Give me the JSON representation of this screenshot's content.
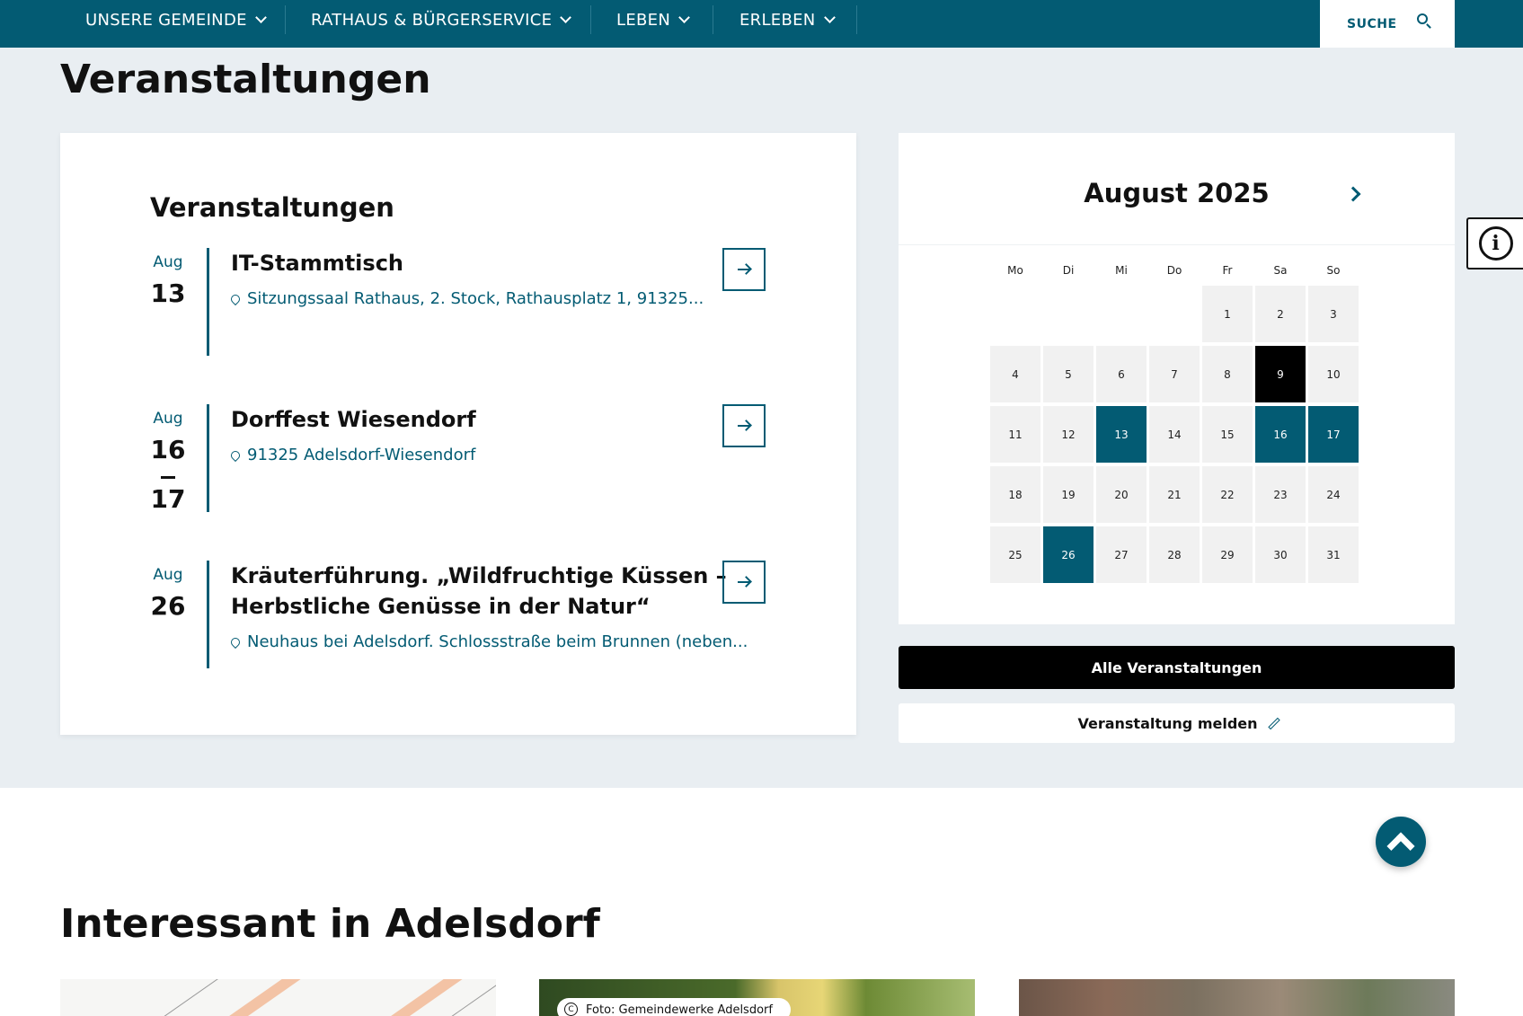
{
  "nav": {
    "items": [
      {
        "label": "UNSERE GEMEINDE"
      },
      {
        "label": "RATHAUS & BÜRGERSERVICE"
      },
      {
        "label": "LEBEN"
      },
      {
        "label": "ERLEBEN"
      }
    ],
    "search_label": "SUCHE"
  },
  "events_section": {
    "heading": "Veranstaltungen",
    "card_title": "Veranstaltungen",
    "events": [
      {
        "month": "Aug",
        "day": "13",
        "title": "IT-Stammtisch",
        "location": "Sitzungssaal Rathaus, 2. Stock, Rathausplatz 1, 91325..."
      },
      {
        "month": "Aug",
        "day": "16",
        "day_end": "17",
        "title": "Dorffest Wiesendorf",
        "location": "91325 Adelsdorf-Wiesendorf"
      },
      {
        "month": "Aug",
        "day": "26",
        "title_line1": "Kräuterführung. „Wildfruchtige Küssen –",
        "title_line2": "Herbstliche Genüsse in der Natur“",
        "location": "Neuhaus bei Adelsdorf. Schlossstraße beim Brunnen (neben..."
      }
    ]
  },
  "calendar": {
    "month_label": "August 2025",
    "weekdays": [
      "Mo",
      "Di",
      "Mi",
      "Do",
      "Fr",
      "Sa",
      "So"
    ],
    "days": [
      {
        "label": "",
        "state": "empty"
      },
      {
        "label": "",
        "state": "empty"
      },
      {
        "label": "",
        "state": "empty"
      },
      {
        "label": "",
        "state": "empty"
      },
      {
        "label": "1",
        "state": "normal"
      },
      {
        "label": "2",
        "state": "normal"
      },
      {
        "label": "3",
        "state": "normal"
      },
      {
        "label": "4",
        "state": "normal"
      },
      {
        "label": "5",
        "state": "normal"
      },
      {
        "label": "6",
        "state": "normal"
      },
      {
        "label": "7",
        "state": "normal"
      },
      {
        "label": "8",
        "state": "normal"
      },
      {
        "label": "9",
        "state": "today"
      },
      {
        "label": "10",
        "state": "normal"
      },
      {
        "label": "11",
        "state": "normal"
      },
      {
        "label": "12",
        "state": "normal"
      },
      {
        "label": "13",
        "state": "event"
      },
      {
        "label": "14",
        "state": "normal"
      },
      {
        "label": "15",
        "state": "normal"
      },
      {
        "label": "16",
        "state": "event"
      },
      {
        "label": "17",
        "state": "event"
      },
      {
        "label": "18",
        "state": "normal"
      },
      {
        "label": "19",
        "state": "normal"
      },
      {
        "label": "20",
        "state": "normal"
      },
      {
        "label": "21",
        "state": "normal"
      },
      {
        "label": "22",
        "state": "normal"
      },
      {
        "label": "23",
        "state": "normal"
      },
      {
        "label": "24",
        "state": "normal"
      },
      {
        "label": "25",
        "state": "normal"
      },
      {
        "label": "26",
        "state": "event"
      },
      {
        "label": "27",
        "state": "normal"
      },
      {
        "label": "28",
        "state": "normal"
      },
      {
        "label": "29",
        "state": "normal"
      },
      {
        "label": "30",
        "state": "normal"
      },
      {
        "label": "31",
        "state": "normal"
      }
    ],
    "all_events_label": "Alle Veranstaltungen",
    "report_label": "Veranstaltung melden"
  },
  "interesting": {
    "heading": "Interessant in Adelsdorf",
    "photo_credit": "Foto: Gemeindewerke Adelsdorf"
  },
  "colors": {
    "primary": "#035b73",
    "section_bg": "#e9eef2",
    "today": "#000000"
  },
  "icons": [
    "chevron-down-icon",
    "search-icon",
    "pin-icon",
    "arrow-right-icon",
    "chevron-right-icon",
    "pencil-icon",
    "info-icon",
    "chevron-up-icon",
    "copyright-icon"
  ]
}
